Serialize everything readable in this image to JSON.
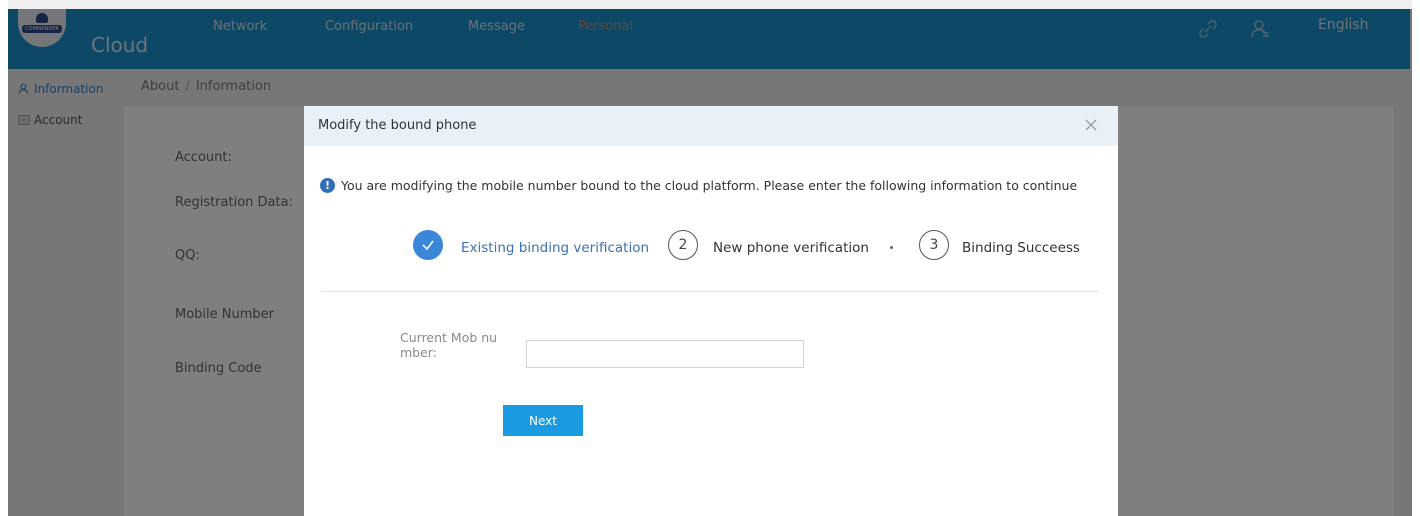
{
  "header": {
    "logo_text": "COMMANDER",
    "brand": "Cloud",
    "nav": [
      "Network",
      "Configuration",
      "Message",
      "Personal"
    ],
    "active_nav": "Personal",
    "language": "English"
  },
  "sidebar": {
    "items": [
      {
        "label": "Information",
        "active": true
      },
      {
        "label": "Account",
        "active": false
      }
    ]
  },
  "breadcrumb": {
    "items": [
      "About",
      "Information"
    ],
    "separator": "/"
  },
  "profile_labels": [
    "Account:",
    "Registration Data:",
    "QQ:",
    "Mobile Number",
    "Binding Code"
  ],
  "dialog": {
    "title": "Modify the bound phone",
    "notice": "You are modifying the mobile number bound to the cloud platform. Please enter the following information to continue",
    "steps": [
      {
        "number": "1",
        "label": "Existing binding verification",
        "status": "done"
      },
      {
        "number": "2",
        "label": "New phone verification",
        "status": "todo"
      },
      {
        "number": "3",
        "label": "Binding Succeess",
        "status": "todo"
      }
    ],
    "form": {
      "label_line1": "Current Mob nu",
      "label_line2": "mber:",
      "value": "",
      "placeholder": ""
    },
    "next_label": "Next"
  },
  "colors": {
    "header_bg": "#1a92cf",
    "accent": "#3a86d9",
    "button": "#1a9ae0",
    "active_nav": "#c98a64"
  }
}
